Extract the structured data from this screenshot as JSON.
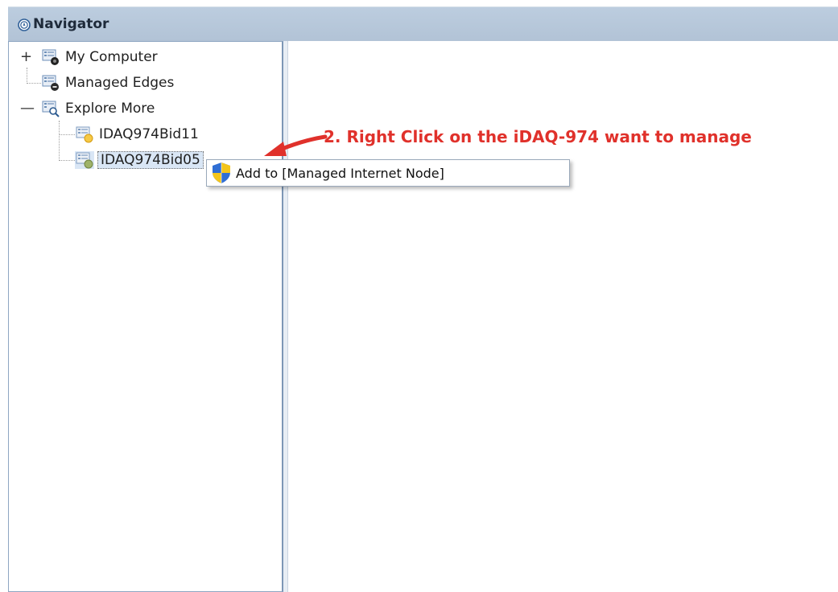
{
  "panel": {
    "title": "Navigator",
    "title_icon": "navigator-icon"
  },
  "tree": {
    "items": [
      {
        "label": "My Computer",
        "icon": "computer-node-icon",
        "expander": "+"
      },
      {
        "label": "Managed Edges",
        "icon": "managed-edges-icon",
        "expander": ""
      },
      {
        "label": "Explore More",
        "icon": "explore-search-icon",
        "expander": "—"
      },
      {
        "label": "IDAQ974Bid11",
        "icon": "device-node-icon",
        "expander": ""
      },
      {
        "label": "IDAQ974Bid05",
        "icon": "device-node-icon",
        "expander": "",
        "selected": true
      }
    ]
  },
  "context_menu": {
    "items": [
      {
        "label": "Add to [Managed Internet Node]",
        "icon": "uac-shield-icon"
      }
    ]
  },
  "annotation": {
    "text": "2. Right Click on the iDAQ-974 want to manage",
    "color": "#e0312b"
  },
  "colors": {
    "titlebar": "#b8c9dc",
    "selection": "#d9e6f5",
    "pane_border": "#8ea6c2"
  }
}
